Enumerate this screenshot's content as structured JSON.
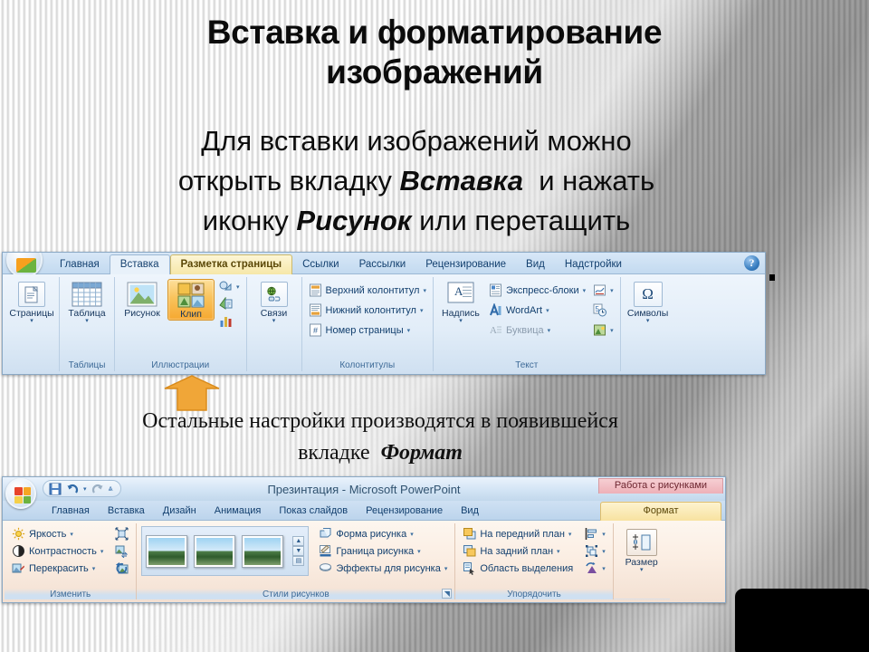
{
  "slide": {
    "title": "Вставка и форматирование изображений",
    "title_lines": [
      "Вставка и форматирование",
      "изображений"
    ],
    "body_lines": [
      "Для вставки изображений можно",
      "открыть вкладку ",
      "Вставка",
      "  и нажать",
      "иконку ",
      "Рисунок",
      " или перетащить"
    ],
    "body_line1": "Для вставки изображений можно",
    "body_line2_a": "открыть вкладку ",
    "body_line2_b": "Вставка",
    "body_line2_c": "  и нажать",
    "body_line3_a": "иконку ",
    "body_line3_b": "Рисунок",
    "body_line3_c": " или перетащить",
    "mid_line1": "Остальные настройки производятся в появившейся",
    "mid_line2_a": "вкладке  ",
    "mid_line2_b": "Формат",
    "callout_arrow": "up-arrow-orange",
    "accent_orange": "#f0a030",
    "accent_blue": "#123f6e"
  },
  "word": {
    "office_button": "office-button",
    "help_button": "?",
    "tabs": [
      {
        "label": "Главная",
        "state": "normal"
      },
      {
        "label": "Вставка",
        "state": "active"
      },
      {
        "label": "Разметка страницы",
        "state": "selected-sheet"
      },
      {
        "label": "Ссылки",
        "state": "normal"
      },
      {
        "label": "Рассылки",
        "state": "normal"
      },
      {
        "label": "Рецензирование",
        "state": "normal"
      },
      {
        "label": "Вид",
        "state": "normal"
      },
      {
        "label": "Надстройки",
        "state": "normal"
      }
    ],
    "groups": [
      {
        "name": "",
        "buttons": [
          {
            "label": "Страницы",
            "icon": "page-icon",
            "caret": "▾"
          }
        ]
      },
      {
        "name": "Таблицы",
        "buttons": [
          {
            "label": "Таблица",
            "icon": "table-icon",
            "caret": "▾"
          }
        ]
      },
      {
        "name": "Иллюстрации",
        "buttons": [
          {
            "label": "Рисунок",
            "icon": "picture-icon",
            "caret": ""
          },
          {
            "label": "Клип",
            "icon": "clipart-icon",
            "caret": "",
            "highlight": true
          }
        ],
        "small": [
          {
            "label": "",
            "icon": "shapes-icon",
            "caret": "▾"
          },
          {
            "label": "",
            "icon": "smartart-icon",
            "caret": ""
          },
          {
            "label": "",
            "icon": "chart-icon",
            "caret": ""
          }
        ]
      },
      {
        "name": "",
        "buttons": [
          {
            "label": "Связи",
            "icon": "hyperlink-icon",
            "caret": "▾"
          }
        ]
      },
      {
        "name": "Колонтитулы",
        "items": [
          {
            "label": "Верхний колонтитул",
            "icon": "header-icon",
            "caret": "▾"
          },
          {
            "label": "Нижний колонтитул",
            "icon": "footer-icon",
            "caret": "▾"
          },
          {
            "label": "Номер страницы",
            "icon": "pagenumber-icon",
            "caret": "▾"
          }
        ]
      },
      {
        "name": "Текст",
        "buttons": [
          {
            "label": "Надпись",
            "icon": "textbox-icon",
            "caret": "▾"
          }
        ],
        "items": [
          {
            "label": "Экспресс-блоки",
            "icon": "quickparts-icon",
            "caret": "▾"
          },
          {
            "label": "WordArt",
            "icon": "wordart-icon",
            "caret": "▾"
          },
          {
            "label": "Буквица",
            "icon": "dropcap-icon",
            "caret": "▾",
            "disabled": true
          }
        ],
        "trail": [
          {
            "icon": "signature-line-icon",
            "caret": "▾"
          },
          {
            "icon": "date-time-icon",
            "caret": ""
          },
          {
            "icon": "object-icon",
            "caret": "▾"
          }
        ]
      },
      {
        "name": "",
        "buttons": [
          {
            "label": "Символы",
            "icon": "omega-icon",
            "glyph": "Ω",
            "caret": "▾"
          }
        ]
      }
    ]
  },
  "powerpoint": {
    "office_button": "office-button",
    "quick_access": [
      {
        "icon": "save-icon",
        "name": "save"
      },
      {
        "icon": "undo-icon",
        "name": "undo",
        "caret": "▾"
      },
      {
        "icon": "redo-icon",
        "name": "redo"
      },
      {
        "icon": "customize-qat-icon",
        "name": "customize",
        "caret": "▾"
      }
    ],
    "document_title": "Презинтация - Microsoft PowerPoint",
    "contextual_group": "Работа с рисунками",
    "tabs": [
      {
        "label": "Главная",
        "state": "normal"
      },
      {
        "label": "Вставка",
        "state": "normal"
      },
      {
        "label": "Дизайн",
        "state": "normal"
      },
      {
        "label": "Анимация",
        "state": "normal"
      },
      {
        "label": "Показ слайдов",
        "state": "normal"
      },
      {
        "label": "Рецензирование",
        "state": "normal"
      },
      {
        "label": "Вид",
        "state": "normal"
      }
    ],
    "contextual_tab": "Формат",
    "groups": [
      {
        "name": "Изменить",
        "items": [
          {
            "label": "Яркость",
            "icon": "brightness-icon",
            "caret": "▾"
          },
          {
            "label": "Контрастность",
            "icon": "contrast-icon",
            "caret": "▾"
          },
          {
            "label": "Перекрасить",
            "icon": "recolor-icon",
            "caret": "▾"
          }
        ],
        "trail": [
          {
            "icon": "compress-pictures-icon"
          },
          {
            "icon": "change-picture-icon"
          },
          {
            "icon": "reset-picture-icon"
          }
        ]
      },
      {
        "name": "Стили рисунков",
        "gallery": [
          "picture-style-1",
          "picture-style-2",
          "picture-style-3"
        ],
        "items": [
          {
            "label": "Форма рисунка",
            "icon": "picture-shape-icon",
            "caret": "▾"
          },
          {
            "label": "Граница рисунка",
            "icon": "picture-border-icon",
            "caret": "▾"
          },
          {
            "label": "Эффекты для рисунка",
            "icon": "picture-effects-icon",
            "caret": "▾"
          }
        ],
        "dialog_launcher": "◥"
      },
      {
        "name": "Упорядочить",
        "items": [
          {
            "label": "На передний план",
            "icon": "bring-to-front-icon",
            "caret": "▾"
          },
          {
            "label": "На задний план",
            "icon": "send-to-back-icon",
            "caret": "▾"
          },
          {
            "label": "Область выделения",
            "icon": "selection-pane-icon",
            "caret": ""
          }
        ],
        "trail": [
          {
            "icon": "align-icon",
            "caret": "▾"
          },
          {
            "icon": "group-icon",
            "caret": "▾"
          },
          {
            "icon": "rotate-icon",
            "caret": "▾"
          }
        ]
      },
      {
        "name": "",
        "buttons": [
          {
            "label": "Размер",
            "icon": "size-icon",
            "caret": "▾"
          }
        ]
      }
    ]
  }
}
